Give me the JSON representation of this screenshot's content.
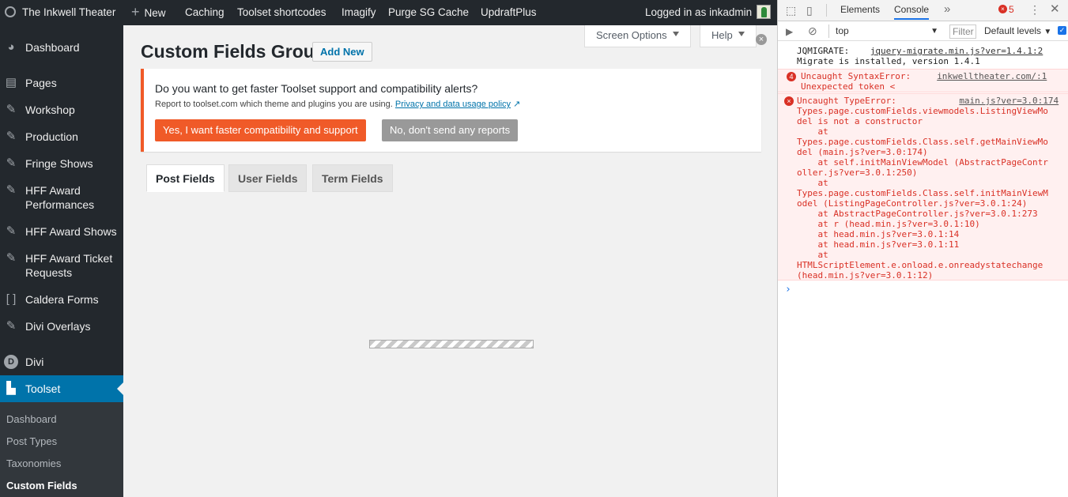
{
  "adminbar": {
    "items": [
      {
        "label": "The Inkwell Theater",
        "icon": "wordpress-icon"
      },
      {
        "label": "New",
        "icon": "plus-icon"
      },
      {
        "label": "Caching"
      },
      {
        "label": "Toolset shortcodes"
      },
      {
        "label": "Imagify"
      },
      {
        "label": "Purge SG Cache"
      },
      {
        "label": "UpdraftPlus"
      }
    ],
    "user": "Logged in as inkadmin"
  },
  "sidebar": {
    "items": [
      {
        "label": "Dashboard",
        "icon": "dashboard-icon"
      },
      {
        "label": "Pages",
        "icon": "pages-icon"
      },
      {
        "label": "Workshop",
        "icon": "pin-icon"
      },
      {
        "label": "Production",
        "icon": "pin-icon"
      },
      {
        "label": "Fringe Shows",
        "icon": "pin-icon"
      },
      {
        "label": "HFF Award Performances",
        "icon": "pin-icon"
      },
      {
        "label": "HFF Award Shows",
        "icon": "pin-icon"
      },
      {
        "label": "HFF Award Ticket Requests",
        "icon": "pin-icon"
      },
      {
        "label": "Caldera Forms",
        "icon": "caldera-icon"
      },
      {
        "label": "Divi Overlays",
        "icon": "pin-icon"
      },
      {
        "label": "Divi",
        "icon": "divi-icon"
      },
      {
        "label": "Toolset",
        "icon": "toolset-icon"
      }
    ],
    "submenu": [
      "Dashboard",
      "Post Types",
      "Taxonomies",
      "Custom Fields"
    ]
  },
  "screen_options": "Screen Options",
  "help": "Help",
  "page_title": "Custom Fields Group",
  "add_new": "Add New",
  "notice": {
    "question": "Do you want to get faster Toolset support and compatibility alerts?",
    "sub": "Report to toolset.com which theme and plugins you are using.",
    "link": "Privacy and data usage policy",
    "yes": "Yes, I want faster compatibility and support",
    "no": "No, don't send any reports"
  },
  "field_tabs": [
    "Post Fields",
    "User Fields",
    "Term Fields"
  ],
  "devtools": {
    "tabs": [
      "Elements",
      "Console"
    ],
    "error_count": "5",
    "context": "top",
    "filter_placeholder": "Filter",
    "levels": "Default levels",
    "logs": [
      {
        "text": "JQMIGRATE:    ",
        "link": "jquery-migrate.min.js?ver=1.4.1:2",
        "text2": "\nMigrate is installed, version 1.4.1"
      },
      {
        "badge": "4",
        "text": "Uncaught SyntaxError:     ",
        "link": "inkwelltheater.com/:1",
        "text2": "\nUnexpected token <"
      },
      {
        "text": "Uncaught TypeError:            ",
        "link": "main.js?ver=3.0:174",
        "text2": "\nTypes.page.customFields.viewmodels.ListingViewMo\ndel is not a constructor\n    at\nTypes.page.customFields.Class.self.getMainViewMo\ndel (main.js?ver=3.0:174)\n    at self.initMainViewModel (AbstractPageContr\noller.js?ver=3.0.1:250)\n    at\nTypes.page.customFields.Class.self.initMainViewM\nodel (ListingPageController.js?ver=3.0.1:24)\n    at AbstractPageController.js?ver=3.0.1:273\n    at r (head.min.js?ver=3.0.1:10)\n    at head.min.js?ver=3.0.1:14\n    at head.min.js?ver=3.0.1:11\n    at\nHTMLScriptElement.e.onload.e.onreadystatechange\n(head.min.js?ver=3.0.1:12)"
      }
    ]
  },
  "colors": {
    "accent": "#0073aa",
    "orange": "#f05a28",
    "error": "#d93025",
    "admin_dark": "#23282d"
  }
}
